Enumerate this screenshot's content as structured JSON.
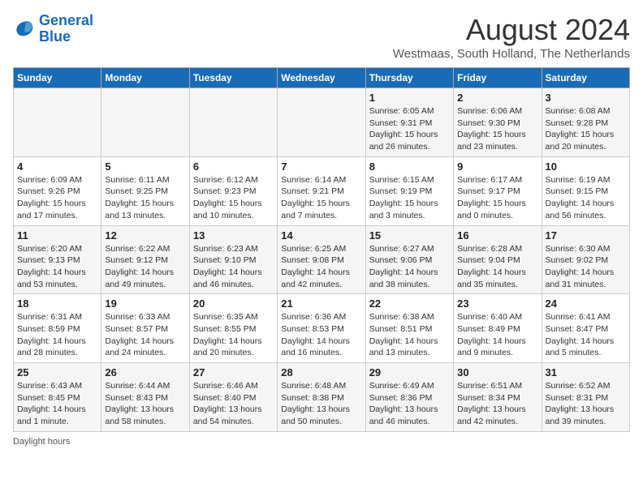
{
  "header": {
    "logo_line1": "General",
    "logo_line2": "Blue",
    "month_year": "August 2024",
    "location": "Westmaas, South Holland, The Netherlands"
  },
  "days_of_week": [
    "Sunday",
    "Monday",
    "Tuesday",
    "Wednesday",
    "Thursday",
    "Friday",
    "Saturday"
  ],
  "weeks": [
    [
      {
        "day": "",
        "info": ""
      },
      {
        "day": "",
        "info": ""
      },
      {
        "day": "",
        "info": ""
      },
      {
        "day": "",
        "info": ""
      },
      {
        "day": "1",
        "info": "Sunrise: 6:05 AM\nSunset: 9:31 PM\nDaylight: 15 hours\nand 26 minutes."
      },
      {
        "day": "2",
        "info": "Sunrise: 6:06 AM\nSunset: 9:30 PM\nDaylight: 15 hours\nand 23 minutes."
      },
      {
        "day": "3",
        "info": "Sunrise: 6:08 AM\nSunset: 9:28 PM\nDaylight: 15 hours\nand 20 minutes."
      }
    ],
    [
      {
        "day": "4",
        "info": "Sunrise: 6:09 AM\nSunset: 9:26 PM\nDaylight: 15 hours\nand 17 minutes."
      },
      {
        "day": "5",
        "info": "Sunrise: 6:11 AM\nSunset: 9:25 PM\nDaylight: 15 hours\nand 13 minutes."
      },
      {
        "day": "6",
        "info": "Sunrise: 6:12 AM\nSunset: 9:23 PM\nDaylight: 15 hours\nand 10 minutes."
      },
      {
        "day": "7",
        "info": "Sunrise: 6:14 AM\nSunset: 9:21 PM\nDaylight: 15 hours\nand 7 minutes."
      },
      {
        "day": "8",
        "info": "Sunrise: 6:15 AM\nSunset: 9:19 PM\nDaylight: 15 hours\nand 3 minutes."
      },
      {
        "day": "9",
        "info": "Sunrise: 6:17 AM\nSunset: 9:17 PM\nDaylight: 15 hours\nand 0 minutes."
      },
      {
        "day": "10",
        "info": "Sunrise: 6:19 AM\nSunset: 9:15 PM\nDaylight: 14 hours\nand 56 minutes."
      }
    ],
    [
      {
        "day": "11",
        "info": "Sunrise: 6:20 AM\nSunset: 9:13 PM\nDaylight: 14 hours\nand 53 minutes."
      },
      {
        "day": "12",
        "info": "Sunrise: 6:22 AM\nSunset: 9:12 PM\nDaylight: 14 hours\nand 49 minutes."
      },
      {
        "day": "13",
        "info": "Sunrise: 6:23 AM\nSunset: 9:10 PM\nDaylight: 14 hours\nand 46 minutes."
      },
      {
        "day": "14",
        "info": "Sunrise: 6:25 AM\nSunset: 9:08 PM\nDaylight: 14 hours\nand 42 minutes."
      },
      {
        "day": "15",
        "info": "Sunrise: 6:27 AM\nSunset: 9:06 PM\nDaylight: 14 hours\nand 38 minutes."
      },
      {
        "day": "16",
        "info": "Sunrise: 6:28 AM\nSunset: 9:04 PM\nDaylight: 14 hours\nand 35 minutes."
      },
      {
        "day": "17",
        "info": "Sunrise: 6:30 AM\nSunset: 9:02 PM\nDaylight: 14 hours\nand 31 minutes."
      }
    ],
    [
      {
        "day": "18",
        "info": "Sunrise: 6:31 AM\nSunset: 8:59 PM\nDaylight: 14 hours\nand 28 minutes."
      },
      {
        "day": "19",
        "info": "Sunrise: 6:33 AM\nSunset: 8:57 PM\nDaylight: 14 hours\nand 24 minutes."
      },
      {
        "day": "20",
        "info": "Sunrise: 6:35 AM\nSunset: 8:55 PM\nDaylight: 14 hours\nand 20 minutes."
      },
      {
        "day": "21",
        "info": "Sunrise: 6:36 AM\nSunset: 8:53 PM\nDaylight: 14 hours\nand 16 minutes."
      },
      {
        "day": "22",
        "info": "Sunrise: 6:38 AM\nSunset: 8:51 PM\nDaylight: 14 hours\nand 13 minutes."
      },
      {
        "day": "23",
        "info": "Sunrise: 6:40 AM\nSunset: 8:49 PM\nDaylight: 14 hours\nand 9 minutes."
      },
      {
        "day": "24",
        "info": "Sunrise: 6:41 AM\nSunset: 8:47 PM\nDaylight: 14 hours\nand 5 minutes."
      }
    ],
    [
      {
        "day": "25",
        "info": "Sunrise: 6:43 AM\nSunset: 8:45 PM\nDaylight: 14 hours\nand 1 minute."
      },
      {
        "day": "26",
        "info": "Sunrise: 6:44 AM\nSunset: 8:43 PM\nDaylight: 13 hours\nand 58 minutes."
      },
      {
        "day": "27",
        "info": "Sunrise: 6:46 AM\nSunset: 8:40 PM\nDaylight: 13 hours\nand 54 minutes."
      },
      {
        "day": "28",
        "info": "Sunrise: 6:48 AM\nSunset: 8:38 PM\nDaylight: 13 hours\nand 50 minutes."
      },
      {
        "day": "29",
        "info": "Sunrise: 6:49 AM\nSunset: 8:36 PM\nDaylight: 13 hours\nand 46 minutes."
      },
      {
        "day": "30",
        "info": "Sunrise: 6:51 AM\nSunset: 8:34 PM\nDaylight: 13 hours\nand 42 minutes."
      },
      {
        "day": "31",
        "info": "Sunrise: 6:52 AM\nSunset: 8:31 PM\nDaylight: 13 hours\nand 39 minutes."
      }
    ]
  ],
  "daylight_label": "Daylight hours"
}
